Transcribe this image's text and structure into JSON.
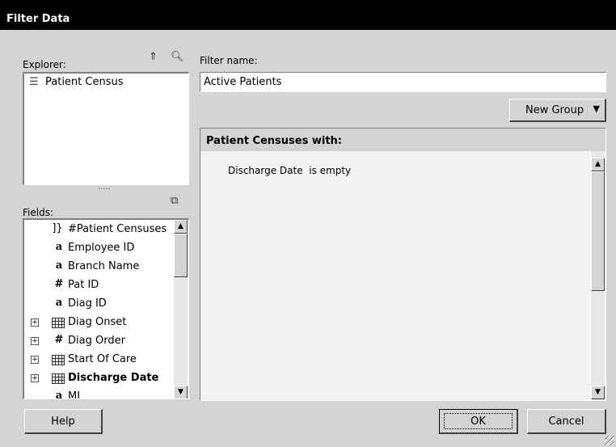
{
  "window": {
    "title": "Filter Data"
  },
  "explorer": {
    "label": "Explorer:",
    "up_icon": "up-arrow-icon",
    "search_icon": "magnifier-icon",
    "items": [
      {
        "label": "Patient Census",
        "icon": "table-list-icon"
      }
    ],
    "splitter": "....."
  },
  "fields": {
    "label": "Fields:",
    "toolbar_icon": "add-field-icon",
    "items": [
      {
        "label": "#Patient Censuses",
        "icon": "bracket-icon",
        "expandable": false,
        "bold": false
      },
      {
        "label": "Employee ID",
        "icon": "text-a-icon",
        "expandable": false,
        "bold": false
      },
      {
        "label": "Branch Name",
        "icon": "text-a-icon",
        "expandable": false,
        "bold": false
      },
      {
        "label": "Pat ID",
        "icon": "number-hash-icon",
        "expandable": false,
        "bold": false
      },
      {
        "label": "Diag ID",
        "icon": "text-a-icon",
        "expandable": false,
        "bold": false
      },
      {
        "label": "Diag Onset",
        "icon": "date-grid-icon",
        "expandable": true,
        "bold": false
      },
      {
        "label": "Diag Order",
        "icon": "number-hash-icon",
        "expandable": true,
        "bold": false
      },
      {
        "label": "Start Of Care",
        "icon": "date-grid-icon",
        "expandable": true,
        "bold": false
      },
      {
        "label": "Discharge Date",
        "icon": "date-grid-icon",
        "expandable": true,
        "bold": true
      },
      {
        "label": "MI",
        "icon": "text-a-icon",
        "expandable": false,
        "bold": false
      }
    ]
  },
  "filter": {
    "name_label": "Filter name:",
    "name_value": "Active Patients",
    "new_group_label": "New Group",
    "panel_title": "Patient Censuses with:",
    "condition_field": "Discharge Date",
    "condition_operator": "is empty"
  },
  "buttons": {
    "help": "Help",
    "ok": "OK",
    "cancel": "Cancel"
  }
}
